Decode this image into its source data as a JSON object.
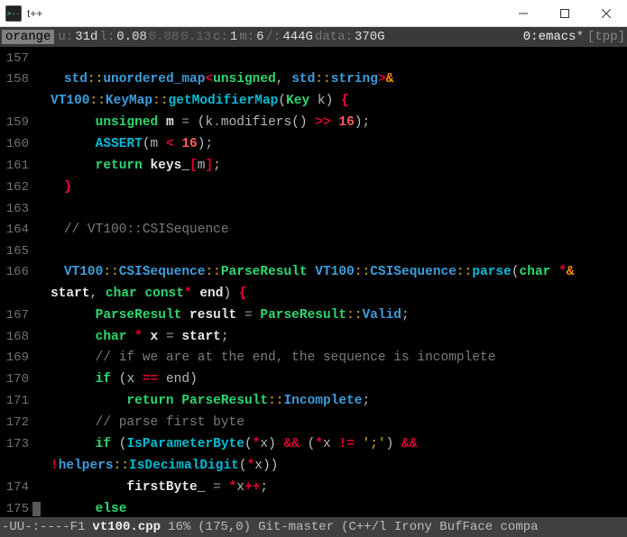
{
  "window": {
    "title": "t++"
  },
  "tmux": {
    "host": "orange",
    "uptime_key": "u:",
    "uptime_val": "31d",
    "load_key": "l:",
    "load1": "0.08",
    "load5": "0.08",
    "load15": "0.13",
    "cpu_key": "c:",
    "cpu_val": "1",
    "mem_key": "m:",
    "mem_val": "6",
    "disk_key": "/:",
    "disk_val": "444G",
    "data_key": "data:",
    "data_val": "370G",
    "win_index": "0:",
    "win_name": "emacs",
    "win_flag": "*",
    "session": "[tpp]"
  },
  "modeline": {
    "left": "-UU-:----F1",
    "file": "vt100.cpp",
    "percent": "16%",
    "pos": "(175,0)",
    "vc": "Git-master",
    "modes": "(C++/l Irony BufFace compa"
  },
  "lines": [
    {
      "n": "157",
      "tokens": []
    },
    {
      "n": "158",
      "tokens": [
        [
          "pad",
          "    "
        ],
        [
          "ns",
          "std"
        ],
        [
          "col",
          "::"
        ],
        [
          "ns",
          "unordered_map"
        ],
        [
          "op",
          "<"
        ],
        [
          "kw",
          "unsigned"
        ],
        [
          "par",
          ", "
        ],
        [
          "ns",
          "std"
        ],
        [
          "col",
          "::"
        ],
        [
          "ns",
          "string"
        ],
        [
          "op",
          ">"
        ],
        [
          "amp",
          "&"
        ]
      ]
    },
    {
      "n": "",
      "wrap": true,
      "tokens": [
        [
          "ns",
          "VT100"
        ],
        [
          "col",
          "::"
        ],
        [
          "ns",
          "KeyMap"
        ],
        [
          "col",
          "::"
        ],
        [
          "fn",
          "getModifierMap"
        ],
        [
          "paren",
          "("
        ],
        [
          "kw",
          "Key"
        ],
        [
          "par",
          " k"
        ],
        [
          "paren",
          ") "
        ],
        [
          "brace",
          "{"
        ]
      ]
    },
    {
      "n": "159",
      "tokens": [
        [
          "pad",
          "        "
        ],
        [
          "kw",
          "unsigned"
        ],
        [
          "par",
          " "
        ],
        [
          "var",
          "m"
        ],
        [
          "par",
          " "
        ],
        [
          "opg",
          "="
        ],
        [
          "par",
          " "
        ],
        [
          "paren",
          "("
        ],
        [
          "par",
          "k"
        ],
        [
          "opg",
          "."
        ],
        [
          "fnc",
          "modifiers"
        ],
        [
          "paren",
          "()"
        ],
        [
          "par",
          " "
        ],
        [
          "op",
          ">>"
        ],
        [
          "par",
          " "
        ],
        [
          "num",
          "16"
        ],
        [
          "paren",
          ")"
        ],
        [
          "par",
          ";"
        ]
      ]
    },
    {
      "n": "160",
      "tokens": [
        [
          "pad",
          "        "
        ],
        [
          "fn",
          "ASSERT"
        ],
        [
          "paren",
          "("
        ],
        [
          "par",
          "m "
        ],
        [
          "op",
          "<"
        ],
        [
          "par",
          " "
        ],
        [
          "num",
          "16"
        ],
        [
          "paren",
          ")"
        ],
        [
          "par",
          ";"
        ]
      ]
    },
    {
      "n": "161",
      "tokens": [
        [
          "pad",
          "        "
        ],
        [
          "kw",
          "return"
        ],
        [
          "par",
          " "
        ],
        [
          "var",
          "keys_"
        ],
        [
          "op",
          "["
        ],
        [
          "par",
          "m"
        ],
        [
          "op",
          "]"
        ],
        [
          "par",
          ";"
        ]
      ]
    },
    {
      "n": "162",
      "tokens": [
        [
          "pad",
          "    "
        ],
        [
          "brace",
          "}"
        ]
      ]
    },
    {
      "n": "163",
      "tokens": []
    },
    {
      "n": "164",
      "tokens": [
        [
          "pad",
          "    "
        ],
        [
          "cmt",
          "// VT100::CSISequence"
        ]
      ]
    },
    {
      "n": "165",
      "tokens": []
    },
    {
      "n": "166",
      "tokens": [
        [
          "pad",
          "    "
        ],
        [
          "ns",
          "VT100"
        ],
        [
          "col",
          "::"
        ],
        [
          "ns",
          "CSISequence"
        ],
        [
          "col",
          "::"
        ],
        [
          "kw",
          "ParseResult"
        ],
        [
          "par",
          " "
        ],
        [
          "ns",
          "VT100"
        ],
        [
          "col",
          "::"
        ],
        [
          "ns",
          "CSISequence"
        ],
        [
          "col",
          "::"
        ],
        [
          "fn",
          "parse"
        ],
        [
          "paren",
          "("
        ],
        [
          "kw",
          "char"
        ],
        [
          "par",
          " "
        ],
        [
          "op",
          "*"
        ],
        [
          "amp",
          "&"
        ]
      ]
    },
    {
      "n": "",
      "wrap": true,
      "tokens": [
        [
          "var",
          "start"
        ],
        [
          "par",
          ", "
        ],
        [
          "kw",
          "char"
        ],
        [
          "par",
          " "
        ],
        [
          "kw",
          "const"
        ],
        [
          "op",
          "*"
        ],
        [
          "par",
          " "
        ],
        [
          "var",
          "end"
        ],
        [
          "paren",
          ") "
        ],
        [
          "brace",
          "{"
        ]
      ]
    },
    {
      "n": "167",
      "tokens": [
        [
          "pad",
          "        "
        ],
        [
          "kw",
          "ParseResult"
        ],
        [
          "par",
          " "
        ],
        [
          "var",
          "result"
        ],
        [
          "par",
          " "
        ],
        [
          "opg",
          "="
        ],
        [
          "par",
          " "
        ],
        [
          "kw",
          "ParseResult"
        ],
        [
          "col",
          "::"
        ],
        [
          "ns",
          "Valid"
        ],
        [
          "par",
          ";"
        ]
      ]
    },
    {
      "n": "168",
      "tokens": [
        [
          "pad",
          "        "
        ],
        [
          "kw",
          "char"
        ],
        [
          "par",
          " "
        ],
        [
          "op",
          "*"
        ],
        [
          "par",
          " "
        ],
        [
          "var",
          "x"
        ],
        [
          "par",
          " "
        ],
        [
          "opg",
          "="
        ],
        [
          "par",
          " "
        ],
        [
          "var",
          "start"
        ],
        [
          "par",
          ";"
        ]
      ]
    },
    {
      "n": "169",
      "tokens": [
        [
          "pad",
          "        "
        ],
        [
          "cmt",
          "// if we are at the end, the sequence is incomplete"
        ]
      ]
    },
    {
      "n": "170",
      "tokens": [
        [
          "pad",
          "        "
        ],
        [
          "kw",
          "if"
        ],
        [
          "par",
          " "
        ],
        [
          "paren",
          "("
        ],
        [
          "par",
          "x "
        ],
        [
          "op",
          "=="
        ],
        [
          "par",
          " end"
        ],
        [
          "paren",
          ")"
        ]
      ]
    },
    {
      "n": "171",
      "tokens": [
        [
          "pad",
          "            "
        ],
        [
          "kw",
          "return"
        ],
        [
          "par",
          " "
        ],
        [
          "kw",
          "ParseResult"
        ],
        [
          "col",
          "::"
        ],
        [
          "ns",
          "Incomplete"
        ],
        [
          "par",
          ";"
        ]
      ]
    },
    {
      "n": "172",
      "tokens": [
        [
          "pad",
          "        "
        ],
        [
          "cmt",
          "// parse first byte"
        ]
      ]
    },
    {
      "n": "173",
      "tokens": [
        [
          "pad",
          "        "
        ],
        [
          "kw",
          "if"
        ],
        [
          "par",
          " "
        ],
        [
          "paren",
          "("
        ],
        [
          "fn",
          "IsParameterByte"
        ],
        [
          "paren",
          "("
        ],
        [
          "op",
          "*"
        ],
        [
          "par",
          "x"
        ],
        [
          "paren",
          ")"
        ],
        [
          "par",
          " "
        ],
        [
          "op",
          "&&"
        ],
        [
          "par",
          " "
        ],
        [
          "paren",
          "("
        ],
        [
          "op",
          "*"
        ],
        [
          "par",
          "x "
        ],
        [
          "op",
          "!="
        ],
        [
          "par",
          " "
        ],
        [
          "str",
          "';'"
        ],
        [
          "paren",
          ")"
        ],
        [
          "par",
          " "
        ],
        [
          "op",
          "&&"
        ]
      ]
    },
    {
      "n": "",
      "wrap": true,
      "tokens": [
        [
          "op",
          "!"
        ],
        [
          "ns",
          "helpers"
        ],
        [
          "col",
          "::"
        ],
        [
          "fn",
          "IsDecimalDigit"
        ],
        [
          "paren",
          "("
        ],
        [
          "op",
          "*"
        ],
        [
          "par",
          "x"
        ],
        [
          "paren",
          "))"
        ]
      ]
    },
    {
      "n": "174",
      "tokens": [
        [
          "pad",
          "            "
        ],
        [
          "var",
          "firstByte_"
        ],
        [
          "par",
          " "
        ],
        [
          "opg",
          "="
        ],
        [
          "par",
          " "
        ],
        [
          "op",
          "*"
        ],
        [
          "par",
          "x"
        ],
        [
          "op",
          "++"
        ],
        [
          "par",
          ";"
        ]
      ]
    },
    {
      "n": "175",
      "tokens": [
        [
          "cursor",
          " "
        ],
        [
          "pad",
          "       "
        ],
        [
          "kw",
          "else"
        ]
      ]
    }
  ]
}
